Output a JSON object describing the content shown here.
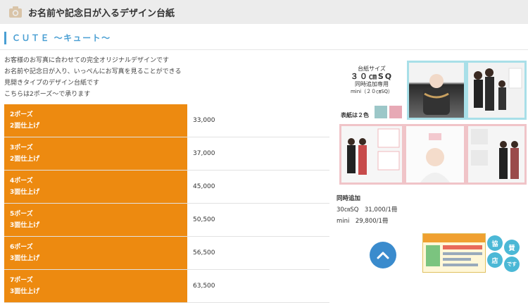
{
  "header": {
    "title": "お名前や記念日が入るデザイン台紙"
  },
  "section": {
    "title": "ＣＵＴＥ 〜キュート〜"
  },
  "description": [
    "お客様のお写真に合わせての完全オリジナルデザインです",
    "お名前や記念日が入り、いっぺんにお写真を見ることができる",
    "見開きタイプのデザイン台紙です",
    "こちらは2ポーズ〜で承ります"
  ],
  "prices": [
    {
      "line1": "2ポーズ",
      "line2": "2面仕上げ",
      "price": "33,000"
    },
    {
      "line1": "3ポーズ",
      "line2": "2面仕上げ",
      "price": "37,000"
    },
    {
      "line1": "4ポーズ",
      "line2": "3面仕上げ",
      "price": "45,000"
    },
    {
      "line1": "5ポーズ",
      "line2": "3面仕上げ",
      "price": "50,500"
    },
    {
      "line1": "6ポーズ",
      "line2": "3面仕上げ",
      "price": "56,500"
    },
    {
      "line1": "7ポーズ",
      "line2": "3面仕上げ",
      "price": "63,500"
    }
  ],
  "spec": {
    "line1": "台紙サイズ",
    "line2": "３０㎝SQ",
    "line3": "同時追加専用",
    "line4": "mini（２０㎝SQ）"
  },
  "covers": {
    "label": "表紙は２色",
    "colors": [
      "#9cc7c8",
      "#e7a9b5"
    ]
  },
  "addon": {
    "title": "同時追加",
    "line1": "30㎝SQ　31,000/1冊",
    "line2": "mini　29,800/1冊"
  },
  "promo": {
    "c1": "協",
    "c2": "賛",
    "c3": "店",
    "c4": "です"
  },
  "colors": {
    "accent": "#4a9fd3",
    "orange": "#ed8a10",
    "scroll": "#3a8bcd"
  }
}
